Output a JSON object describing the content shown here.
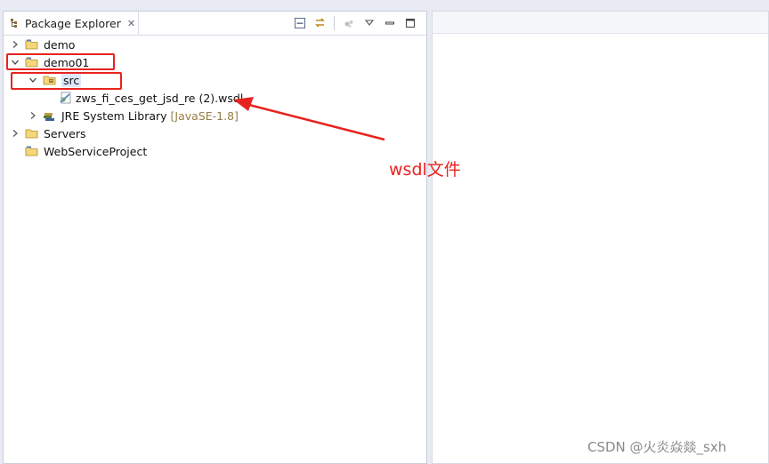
{
  "view": {
    "tab_title": "Package Explorer",
    "tab_close": "✕"
  },
  "tree": [
    {
      "label": "demo",
      "expanded": false,
      "icon": "project-folder-icon"
    },
    {
      "label": "demo01",
      "expanded": true,
      "icon": "project-folder-icon"
    },
    {
      "label": "src",
      "expanded": true,
      "icon": "source-folder-icon"
    },
    {
      "label": "zws_fi_ces_get_jsd_re (2).wsdl",
      "icon": "wsdl-file-icon"
    },
    {
      "label": "JRE System Library",
      "qualifier": "[JavaSE-1.8]",
      "expanded": false,
      "icon": "library-icon"
    },
    {
      "label": "Servers",
      "expanded": false,
      "icon": "folder-icon"
    },
    {
      "label": "WebServiceProject",
      "icon": "project-folder-icon"
    }
  ],
  "annotation": {
    "text": "wsdl文件",
    "color": "#e8231f"
  },
  "watermark": "CSDN @火炎焱燚_sxh",
  "colors": {
    "highlight": "#e8231f",
    "selection": "#dfe8fa",
    "qualifier": "#957d45"
  }
}
